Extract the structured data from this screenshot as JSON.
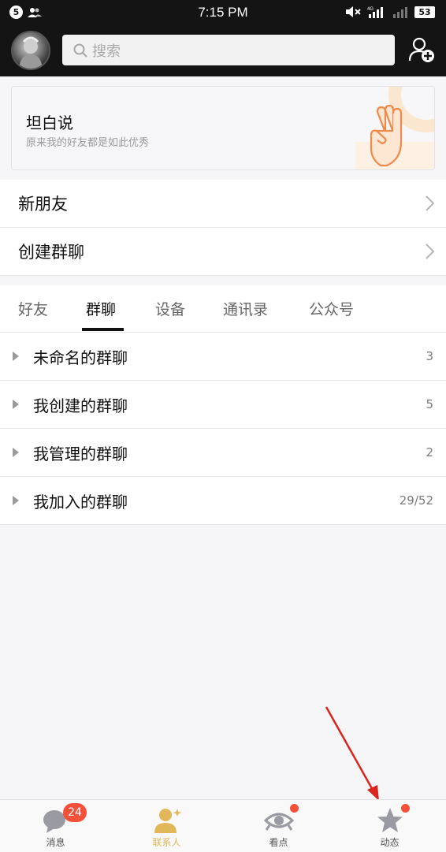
{
  "status_bar": {
    "notification_count": "5",
    "time": "7:15 PM",
    "network": "4G",
    "battery": "53"
  },
  "header": {
    "search_placeholder": "搜索"
  },
  "banner": {
    "title": "坦白说",
    "subtitle": "原来我的好友都是如此优秀"
  },
  "quick_rows": [
    {
      "label": "新朋友"
    },
    {
      "label": "创建群聊"
    }
  ],
  "tabs": [
    {
      "label": "好友",
      "active": false
    },
    {
      "label": "群聊",
      "active": true
    },
    {
      "label": "设备",
      "active": false
    },
    {
      "label": "通讯录",
      "active": false
    },
    {
      "label": "公众号",
      "active": false
    }
  ],
  "groups": [
    {
      "label": "未命名的群聊",
      "count": "3"
    },
    {
      "label": "我创建的群聊",
      "count": "5"
    },
    {
      "label": "我管理的群聊",
      "count": "2"
    },
    {
      "label": "我加入的群聊",
      "count": "29/52"
    }
  ],
  "bottom_nav": [
    {
      "label": "消息",
      "icon": "chat-bubble-icon",
      "badge": "24"
    },
    {
      "label": "联系人",
      "icon": "contact-person-icon",
      "active": true
    },
    {
      "label": "看点",
      "icon": "eye-icon",
      "dot": true
    },
    {
      "label": "动态",
      "icon": "star-icon",
      "dot": true
    }
  ],
  "colors": {
    "accent": "#e0b85a",
    "badge": "#f4513b",
    "header_bg": "#141414",
    "annotation_arrow": "#d9251d"
  }
}
